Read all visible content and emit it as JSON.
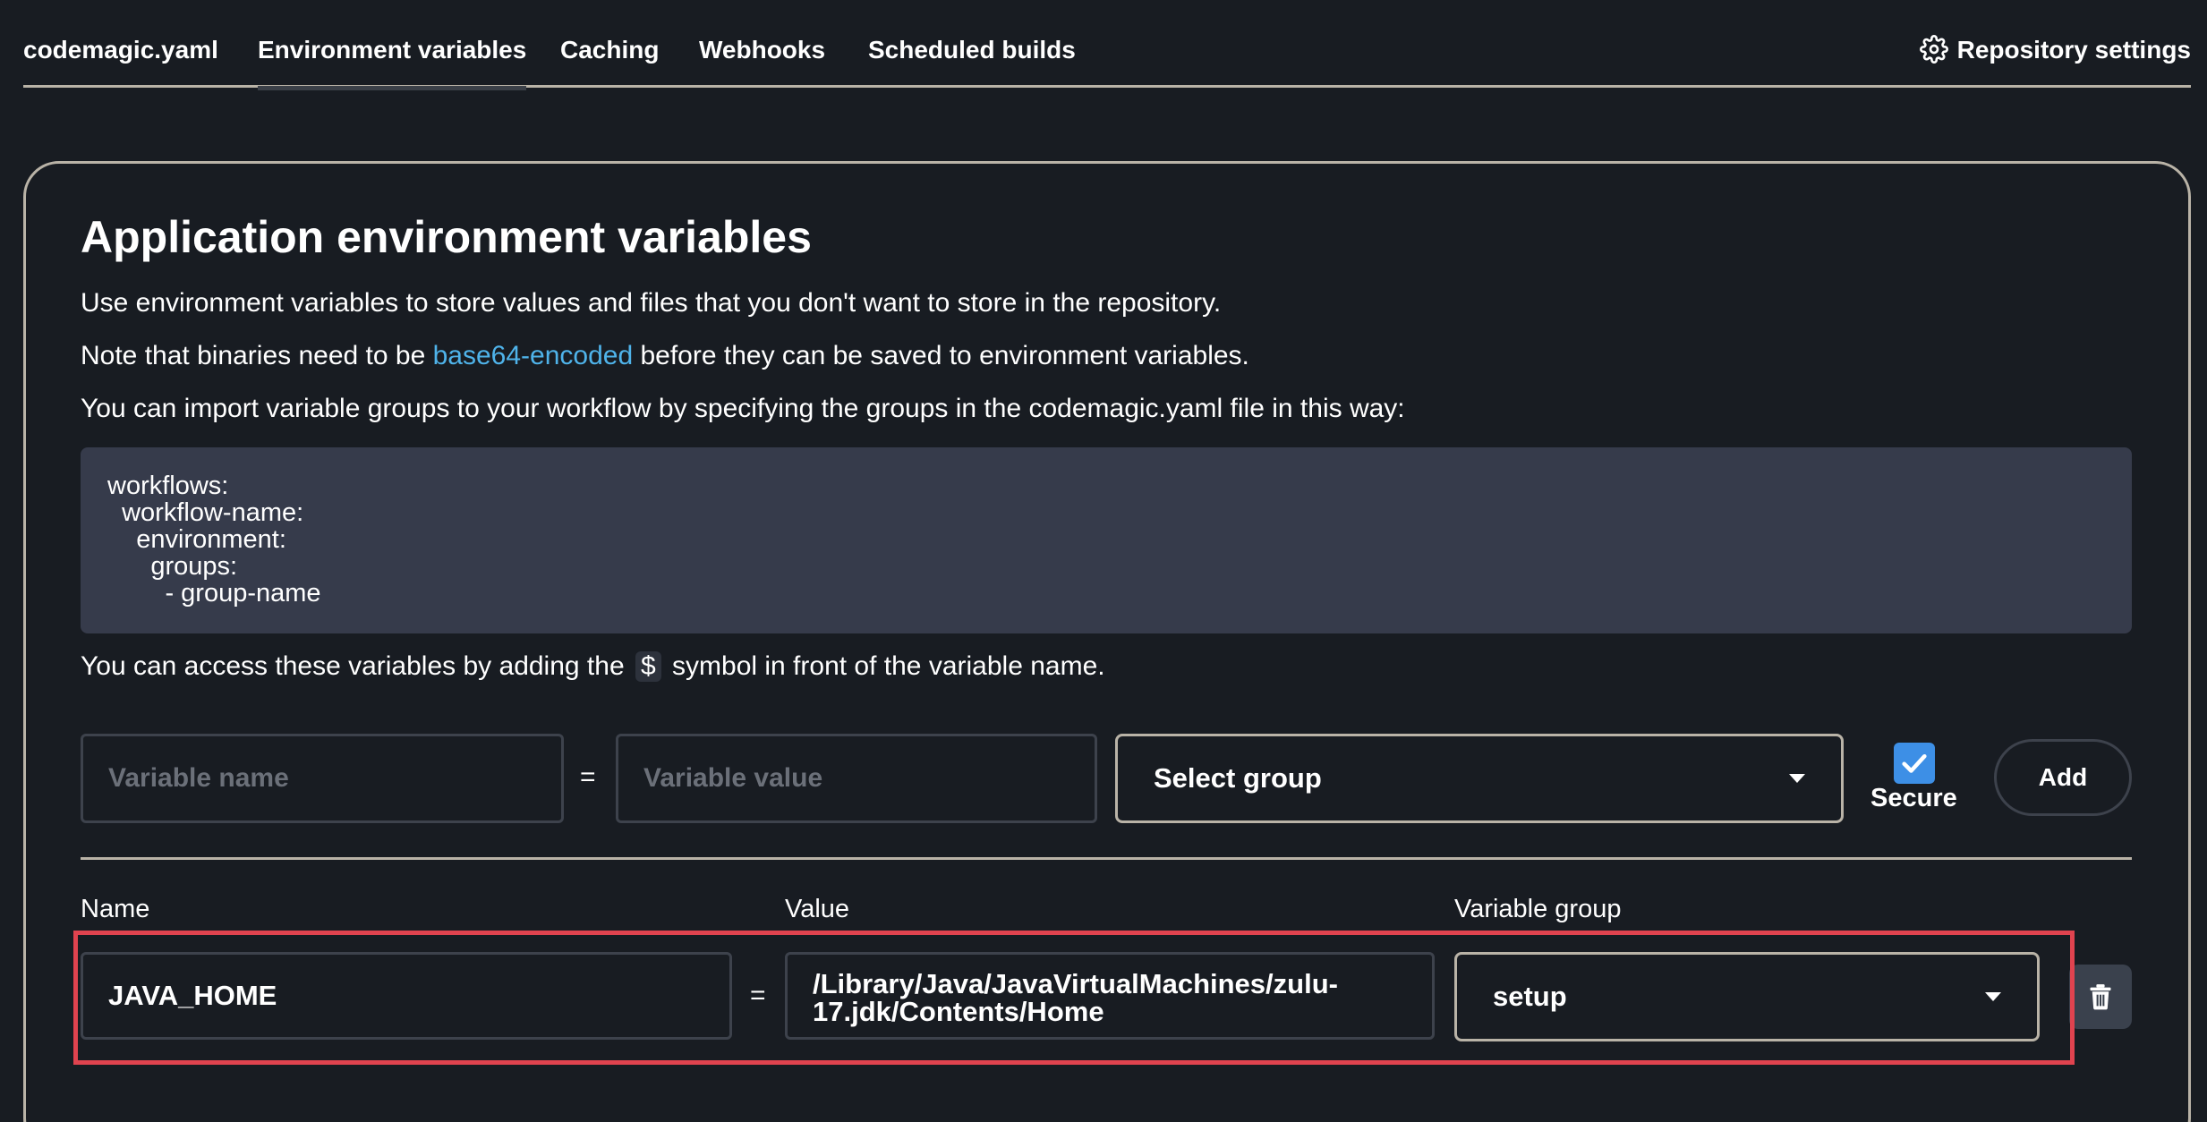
{
  "tabs": [
    {
      "label": "codemagic.yaml"
    },
    {
      "label": "Environment variables"
    },
    {
      "label": "Caching"
    },
    {
      "label": "Webhooks"
    },
    {
      "label": "Scheduled builds"
    }
  ],
  "repository_settings_label": "Repository settings",
  "heading": "Application environment variables",
  "intro": {
    "line1": "Use environment variables to store values and files that you don't want to store in the repository.",
    "line2_before": "Note that binaries need to be ",
    "line2_link": "base64-encoded",
    "line2_after": " before they can be saved to environment variables.",
    "line3": "You can import variable groups to your workflow by specifying the groups in the codemagic.yaml file in this way:"
  },
  "code_lines": [
    "workflows:",
    "  workflow-name:",
    "    environment:",
    "      groups:",
    "        - group-name"
  ],
  "access_note": {
    "before": "You can access these variables by adding the",
    "symbol": "$",
    "after": "symbol in front of the variable name."
  },
  "add_form": {
    "name_placeholder": "Variable name",
    "equals": "=",
    "value_placeholder": "Variable value",
    "group_select": "Select group",
    "secure_label": "Secure",
    "secure_checked": true,
    "add_label": "Add"
  },
  "table": {
    "headers": {
      "name": "Name",
      "value": "Value",
      "group": "Variable group"
    },
    "rows": [
      {
        "name": "JAVA_HOME",
        "equals": "=",
        "value_line1": "/Library/Java/JavaVirtualMachines/zulu-",
        "value_line2": "17.jdk/Contents/Home",
        "group": "setup"
      }
    ]
  },
  "colors": {
    "background": "#181c22",
    "link": "#4fb3ea",
    "highlight_border": "#e0434f",
    "checkbox": "#3d8fe6",
    "code_bg": "#363b4b"
  }
}
